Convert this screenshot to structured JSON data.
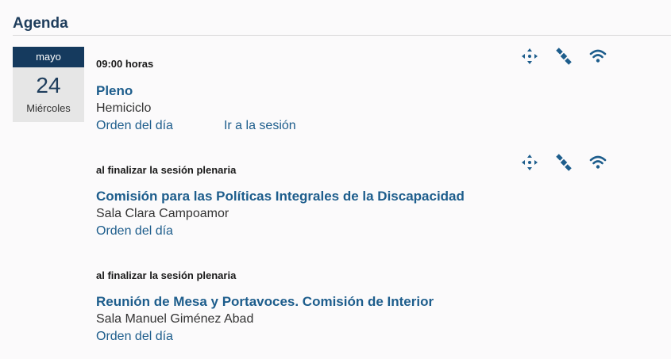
{
  "agenda": {
    "title": "Agenda"
  },
  "date": {
    "month": "mayo",
    "day": "24",
    "weekday": "Miércoles"
  },
  "events": [
    {
      "time": "09:00 horas",
      "title": "Pleno",
      "room": "Hemiciclo",
      "links": [
        "Orden del día",
        "Ir a la sesión"
      ],
      "icons": [
        "move-icon",
        "satellite-icon",
        "wifi-icon"
      ]
    },
    {
      "time": "al finalizar la sesión plenaria",
      "title": "Comisión para las Políticas Integrales de la Discapacidad",
      "room": "Sala Clara Campoamor",
      "links": [
        "Orden del día"
      ],
      "icons": [
        "move-icon",
        "satellite-icon",
        "wifi-icon"
      ]
    },
    {
      "time": "al finalizar la sesión plenaria",
      "title": "Reunión de Mesa y Portavoces. Comisión de Interior",
      "room": "Sala Manuel Giménez Abad",
      "links": [
        "Orden del día"
      ],
      "icons": []
    }
  ],
  "colors": {
    "accent": "#1d5d8c",
    "header": "#153a5e",
    "icon": "#1d5d8c"
  }
}
